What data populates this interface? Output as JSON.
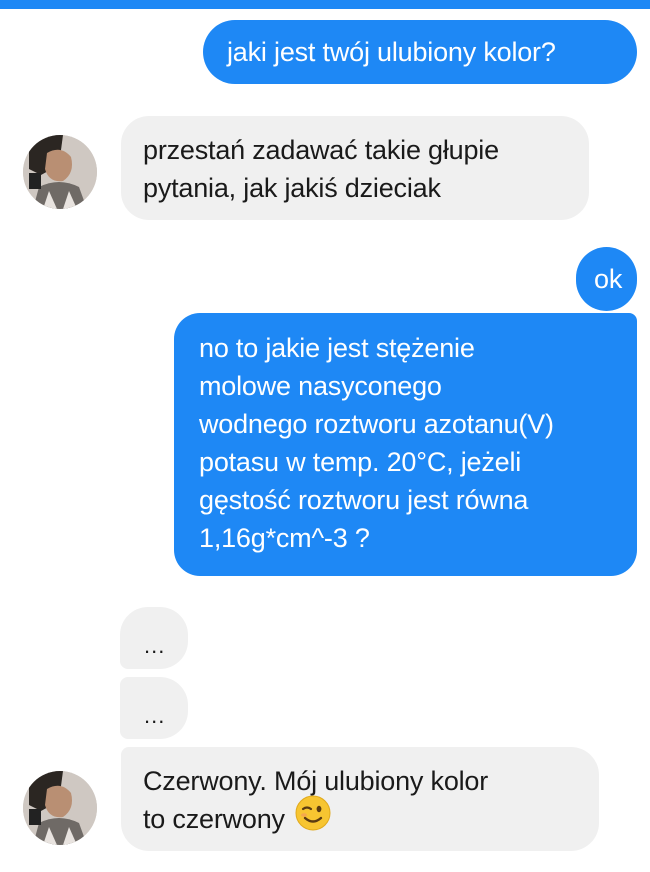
{
  "conversation": {
    "messages": [
      {
        "from": "me",
        "text": "jaki jest twój ulubiony kolor?"
      },
      {
        "from": "contact",
        "lines": [
          "przestań zadawać takie głupie",
          "pytania, jak jakiś dzieciak"
        ]
      },
      {
        "from": "me",
        "text": "ok"
      },
      {
        "from": "me",
        "lines": [
          "no to jakie jest stężenie",
          "molowe nasyconego",
          "wodnego roztworu azotanu(V)",
          "potasu w temp. 20°C, jeżeli",
          "gęstość roztworu jest równa",
          "1,16g*cm^-3 ?"
        ]
      },
      {
        "from": "contact",
        "text": "..."
      },
      {
        "from": "contact",
        "text": "..."
      },
      {
        "from": "contact",
        "lines": [
          "Czerwony. Mój ulubiony kolor",
          "to czerwony"
        ],
        "emoji": "winking-face-emoji"
      }
    ]
  },
  "colors": {
    "sent_bubble": "#1e88f5",
    "received_bubble": "#f0f0f0",
    "sent_text": "#ffffff",
    "received_text": "#1a1a1a",
    "emoji_yellow": "#f7c531"
  }
}
